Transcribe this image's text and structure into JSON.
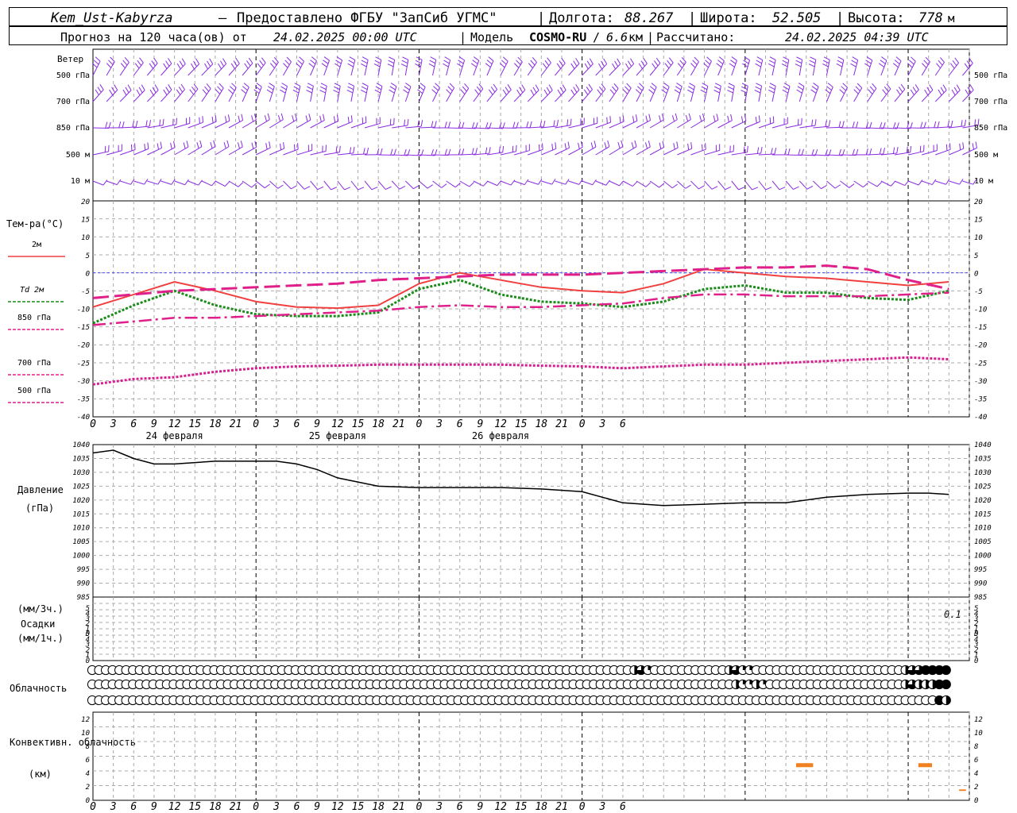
{
  "header": {
    "station": "Kem_Ust-Kabyrza",
    "provided": "Предоставлено ФГБУ \"ЗапСиб УГМС\"",
    "lon_label": "Долгота:",
    "lon": "88.267",
    "lat_label": "Широта:",
    "lat": "52.505",
    "alt_label": "Высота:",
    "alt": "778",
    "alt_unit": "м",
    "forecast_label": "Прогноз на 120 часа(ов) от",
    "forecast_date": "24.02.2025 00:00 UTC",
    "model_label": "Модель",
    "model": "COSMO-RU",
    "model_res": "6.6",
    "model_res_unit": "км",
    "calc_label": "Рассчитано:",
    "calc_date": "24.02.2025 04:39 UTC"
  },
  "colors": {
    "wind": "#8a2be2",
    "t2m": "#f04040",
    "td2m": "#1a8c1a",
    "t850": "#e0208a",
    "t700": "#e0208a",
    "t500": "#d62090",
    "pressure": "#000000",
    "convective": "#f08020",
    "grid": "#aaaaaa",
    "zero_line": "#4040ff"
  },
  "time_axis": {
    "ticks": [
      "0",
      "3",
      "6",
      "9",
      "12",
      "15",
      "18",
      "21",
      "0",
      "3",
      "6",
      "9",
      "12",
      "15",
      "18",
      "21",
      "0",
      "3",
      "6",
      "9",
      "12",
      "15",
      "18",
      "21",
      "0",
      "3",
      "6"
    ],
    "dates": [
      "24 февраля",
      "25 февраля",
      "26 февраля"
    ]
  },
  "wind": {
    "title": "Ветер",
    "levels": [
      "500 гПа",
      "700 гПа",
      "850 гПа",
      "500 м",
      "10  м"
    ]
  },
  "chart_data": [
    {
      "type": "line",
      "title": "Тем-ра(°C)",
      "x_hours": [
        0,
        6,
        12,
        18,
        24,
        30,
        36,
        42,
        48,
        54,
        60,
        66,
        72,
        78,
        84,
        90,
        96,
        102,
        108,
        114,
        120,
        126
      ],
      "ylim": [
        -40,
        20
      ],
      "yticks": [
        "20",
        "15",
        "10",
        "5",
        "0",
        "-5",
        "-10",
        "-15",
        "-20",
        "-25",
        "-30",
        "-35",
        "-40"
      ],
      "series": [
        {
          "name": "2м",
          "values": [
            -9.5,
            -6,
            -2.5,
            -5,
            -8,
            -9.5,
            -9.8,
            -9,
            -3,
            0,
            -2,
            -4,
            -5,
            -5.5,
            -3,
            1,
            0,
            -1,
            -1.5,
            -2.5,
            -3.5,
            -2.5
          ]
        },
        {
          "name": "Td  2м",
          "values": [
            -14,
            -9,
            -5,
            -9,
            -11.5,
            -12,
            -12,
            -11,
            -4.5,
            -2,
            -6,
            -8,
            -8.5,
            -9.5,
            -8,
            -4.5,
            -3.5,
            -5.5,
            -5.5,
            -7,
            -7.5,
            -5
          ]
        },
        {
          "name": "850 гПа",
          "values": [
            -14.5,
            -13.5,
            -12.5,
            -12.5,
            -12,
            -11.5,
            -11,
            -10.5,
            -9.5,
            -9,
            -9.5,
            -9.5,
            -9,
            -8.5,
            -7,
            -6,
            -6,
            -6.5,
            -6.5,
            -6.5,
            -6,
            -5.5
          ]
        },
        {
          "name": "700 гПа",
          "values": [
            -7,
            -6,
            -5,
            -4.5,
            -4,
            -3.5,
            -3,
            -2,
            -1.5,
            -1,
            -0.5,
            -0.5,
            -0.5,
            0,
            0.5,
            1,
            1.5,
            1.5,
            2,
            1,
            -2,
            -4.5
          ]
        },
        {
          "name": "500 гПа",
          "values": [
            -31,
            -29.5,
            -29,
            -27.5,
            -26.5,
            -26,
            -25.8,
            -25.5,
            -25.5,
            -25.5,
            -25.5,
            -25.8,
            -26,
            -26.5,
            -26,
            -25.5,
            -25.5,
            -25,
            -24.5,
            -24,
            -23.5,
            -24
          ]
        }
      ]
    },
    {
      "type": "line",
      "title": "Давление",
      "unit": "(гПа)",
      "x_hours": [
        0,
        3,
        6,
        9,
        12,
        18,
        24,
        27,
        30,
        33,
        36,
        42,
        48,
        54,
        60,
        66,
        72,
        78,
        84,
        90,
        96,
        102,
        108,
        114,
        120,
        123,
        126
      ],
      "ylim": [
        985,
        1040
      ],
      "yticks": [
        "1040",
        "1035",
        "1030",
        "1025",
        "1020",
        "1015",
        "1010",
        "1005",
        "1000",
        "995",
        "990",
        "985"
      ],
      "series": [
        {
          "name": "Давление",
          "values": [
            1037,
            1038,
            1035,
            1033,
            1033,
            1034,
            1034,
            1034,
            1033,
            1031,
            1028,
            1025,
            1024.5,
            1024.5,
            1024.5,
            1024,
            1023,
            1019,
            1018,
            1018.5,
            1019,
            1019,
            1021,
            1022,
            1022.5,
            1022.5,
            1022
          ]
        }
      ]
    },
    {
      "type": "bar",
      "title": "Осадки",
      "unit_top": "(мм/3ч.)",
      "unit_bottom": "(мм/1ч.)",
      "ylim": [
        0,
        5
      ],
      "yticks": [
        "5",
        "4",
        "3",
        "2",
        "1",
        "0",
        "5",
        "4",
        "3",
        "2",
        "1",
        "0"
      ],
      "annotation": "0.1",
      "values": [
        0
      ]
    },
    {
      "type": "bar",
      "title": "Конвективн. облачность",
      "unit": "(км)",
      "ylim": [
        0,
        13
      ],
      "yticks": [
        "12",
        "10",
        "8",
        "6",
        "4",
        "2",
        "0"
      ],
      "bars": [
        {
          "x_start": 103.5,
          "x_end": 106,
          "base": 5,
          "top": 5.5
        },
        {
          "x_start": 121.5,
          "x_end": 123.5,
          "base": 5,
          "top": 5.5
        }
      ]
    }
  ],
  "clouds": {
    "title": "Облачность",
    "rows": [
      {
        "name": "upper",
        "filled_quarters": [
          0,
          0,
          0,
          0,
          0,
          0,
          0,
          0,
          0,
          0,
          0,
          0,
          0,
          0,
          0,
          0,
          0,
          0,
          0,
          0,
          0,
          0,
          0,
          0,
          0,
          0,
          0,
          0,
          0,
          0,
          0,
          0,
          0,
          0,
          0,
          0,
          0,
          0,
          0,
          0,
          0,
          0,
          0,
          0,
          0,
          0,
          0,
          0,
          0,
          0,
          0,
          0,
          0,
          0,
          0,
          0,
          0,
          0,
          0,
          0,
          0,
          0,
          0,
          0,
          0,
          0,
          0,
          0,
          0,
          0,
          0,
          0,
          0,
          0,
          0,
          0,
          0,
          0,
          0,
          0,
          2,
          3,
          1,
          0,
          0,
          0,
          0,
          0,
          0,
          0,
          0,
          0,
          0,
          0,
          2,
          3,
          1,
          1,
          0,
          0,
          0,
          0,
          0,
          0,
          0,
          0,
          0,
          0,
          0,
          0,
          0,
          0,
          0,
          0,
          0,
          0,
          0,
          0,
          0,
          0,
          2,
          3,
          3,
          4,
          4,
          4,
          4
        ]
      },
      {
        "name": "middle",
        "filled_quarters": [
          0,
          0,
          0,
          0,
          0,
          0,
          0,
          0,
          0,
          0,
          0,
          0,
          0,
          0,
          0,
          0,
          0,
          0,
          0,
          0,
          0,
          0,
          0,
          0,
          0,
          0,
          0,
          0,
          0,
          0,
          0,
          0,
          0,
          0,
          0,
          0,
          0,
          0,
          0,
          0,
          0,
          0,
          0,
          0,
          0,
          0,
          0,
          0,
          0,
          0,
          0,
          0,
          0,
          0,
          0,
          0,
          0,
          0,
          0,
          0,
          0,
          0,
          0,
          0,
          0,
          0,
          0,
          0,
          0,
          0,
          0,
          0,
          0,
          0,
          0,
          0,
          0,
          0,
          0,
          0,
          0,
          0,
          0,
          0,
          0,
          0,
          0,
          0,
          0,
          0,
          0,
          0,
          0,
          0,
          0,
          2,
          1,
          1,
          2,
          1,
          0,
          0,
          0,
          0,
          0,
          0,
          0,
          0,
          0,
          0,
          0,
          0,
          0,
          0,
          0,
          0,
          0,
          0,
          0,
          0,
          2,
          3,
          2,
          2,
          2,
          4,
          4
        ]
      },
      {
        "name": "lower",
        "filled_quarters": [
          0,
          0,
          0,
          0,
          0,
          0,
          0,
          0,
          0,
          0,
          0,
          0,
          0,
          0,
          0,
          0,
          0,
          0,
          0,
          0,
          0,
          0,
          0,
          0,
          0,
          0,
          0,
          0,
          0,
          0,
          0,
          0,
          0,
          0,
          0,
          0,
          0,
          0,
          0,
          0,
          0,
          0,
          0,
          0,
          0,
          0,
          0,
          0,
          0,
          0,
          0,
          0,
          0,
          0,
          0,
          0,
          0,
          0,
          0,
          0,
          0,
          0,
          0,
          0,
          0,
          0,
          0,
          0,
          0,
          0,
          0,
          0,
          0,
          0,
          0,
          0,
          0,
          0,
          0,
          0,
          0,
          0,
          0,
          0,
          0,
          0,
          0,
          0,
          0,
          0,
          0,
          0,
          0,
          0,
          0,
          0,
          0,
          0,
          0,
          0,
          0,
          0,
          0,
          0,
          0,
          0,
          0,
          0,
          0,
          0,
          0,
          0,
          0,
          0,
          0,
          0,
          0,
          0,
          0,
          0,
          0,
          0,
          0,
          0,
          0,
          4,
          2
        ]
      }
    ]
  }
}
